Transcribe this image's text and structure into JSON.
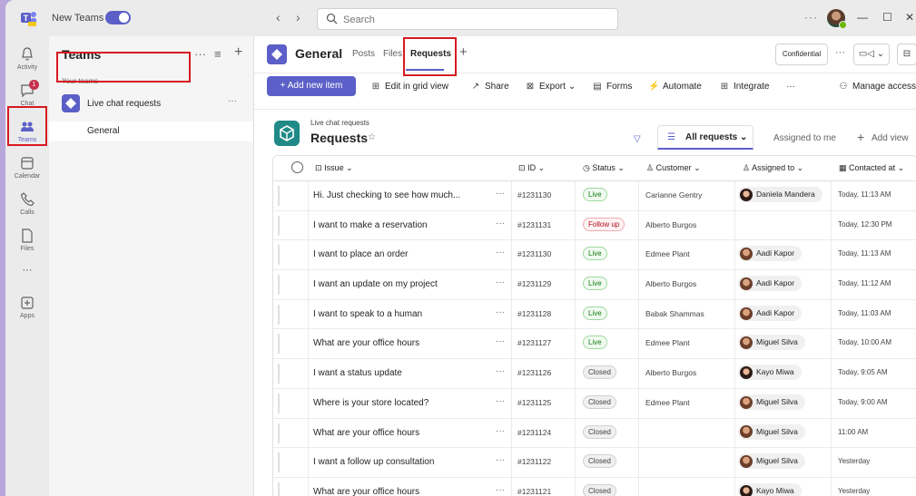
{
  "titlebar": {
    "new_teams_label": "New Teams",
    "search_placeholder": "Search",
    "more": "···",
    "minimize": "—",
    "maximize": "☐",
    "close": "✕"
  },
  "rail": {
    "items": [
      {
        "label": "Activity",
        "icon": "bell-icon"
      },
      {
        "label": "Chat",
        "icon": "chat-icon",
        "badge": "1"
      },
      {
        "label": "Teams",
        "icon": "teams-icon",
        "active": true
      },
      {
        "label": "Calendar",
        "icon": "calendar-icon"
      },
      {
        "label": "Calls",
        "icon": "phone-icon"
      },
      {
        "label": "Files",
        "icon": "file-icon"
      },
      {
        "label": "···",
        "icon": "more-icon"
      },
      {
        "label": "Apps",
        "icon": "apps-icon"
      }
    ]
  },
  "teams_pane": {
    "title": "Teams",
    "section_label": "Your teams",
    "team_name": "Live chat requests",
    "channel_name": "General"
  },
  "channel": {
    "title": "General",
    "tabs": [
      "Posts",
      "Files",
      "Requests"
    ],
    "active_tab": "Requests",
    "add_tab": "+",
    "sensitivity": "Confidential"
  },
  "toolbar": {
    "add_item": "Add new item",
    "actions": [
      "Edit in grid view",
      "Share",
      "Export",
      "Forms",
      "Automate",
      "Integrate"
    ],
    "more": "···",
    "manage_access": "Manage access"
  },
  "list": {
    "parent": "Live chat requests",
    "title": "Requests",
    "views": {
      "active": "All requests",
      "other": "Assigned to me",
      "add": "Add view"
    },
    "columns": [
      "Issue",
      "ID",
      "Status",
      "Customer",
      "Assigned to",
      "Contacted at"
    ],
    "rows": [
      {
        "issue": "Hi. Just checking to see how much...",
        "id": "#1231130",
        "status": "Live",
        "customer": "Carianne Gentry",
        "assigned": "Daniela Mandera",
        "avatar": "f",
        "contacted": "Today, 11:13 AM"
      },
      {
        "issue": "I want to make a reservation",
        "id": "#1231131",
        "status": "Follow up",
        "customer": "Alberto Burgos",
        "assigned": "",
        "avatar": "",
        "contacted": "Today, 12:30 PM"
      },
      {
        "issue": "I want to place an order",
        "id": "#1231130",
        "status": "Live",
        "customer": "Edmee Plant",
        "assigned": "Aadi Kapor",
        "avatar": "m",
        "contacted": "Today, 11:13 AM"
      },
      {
        "issue": "I want an update on my project",
        "id": "#1231129",
        "status": "Live",
        "customer": "Alberto Burgos",
        "assigned": "Aadi Kapor",
        "avatar": "m",
        "contacted": "Today, 11:12 AM"
      },
      {
        "issue": "I want to speak to a human",
        "id": "#1231128",
        "status": "Live",
        "customer": "Babak Shammas",
        "assigned": "Aadi Kapor",
        "avatar": "m",
        "contacted": "Today, 11:03 AM"
      },
      {
        "issue": "What are your office hours",
        "id": "#1231127",
        "status": "Live",
        "customer": "Edmee Plant",
        "assigned": "Miguel Silva",
        "avatar": "m",
        "contacted": "Today, 10:00 AM"
      },
      {
        "issue": "I want a status update",
        "id": "#1231126",
        "status": "Closed",
        "customer": "Alberto Burgos",
        "assigned": "Kayo Miwa",
        "avatar": "f",
        "contacted": "Today, 9:05 AM"
      },
      {
        "issue": "Where is your store located?",
        "id": "#1231125",
        "status": "Closed",
        "customer": "Edmee Plant",
        "assigned": "Miguel Silva",
        "avatar": "m",
        "contacted": "Today, 9:00 AM"
      },
      {
        "issue": "What are your office hours",
        "id": "#1231124",
        "status": "Closed",
        "customer": "",
        "assigned": "Miguel Silva",
        "avatar": "m",
        "contacted": "11:00 AM"
      },
      {
        "issue": "I want a follow up consultation",
        "id": "#1231122",
        "status": "Closed",
        "customer": "",
        "assigned": "Miguel Silva",
        "avatar": "m",
        "contacted": "Yesterday"
      },
      {
        "issue": "What are your office hours",
        "id": "#1231121",
        "status": "Closed",
        "customer": "",
        "assigned": "Kayo Miwa",
        "avatar": "f",
        "contacted": "Yesterday"
      }
    ]
  },
  "colors": {
    "accent": "#5b5fc7",
    "highlight": "#d71920",
    "live": "#107c10",
    "follow_up": "#b10e1c"
  }
}
